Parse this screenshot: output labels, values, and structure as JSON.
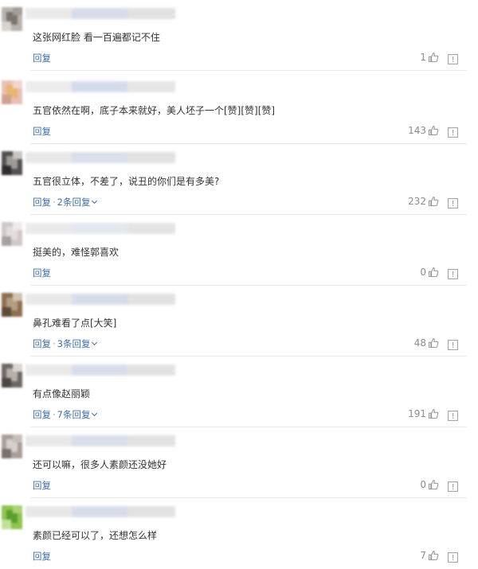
{
  "comments": [
    {
      "text": "这张网红脸 看一百遍都记不住",
      "reply_label": "回复",
      "sub_replies": "",
      "likes": "1",
      "avatar_colors": [
        "#b9b3ad",
        "#7b746f",
        "#d8d3cf",
        "#a39d98"
      ],
      "name_colors": [
        "#e6e6e6",
        "#cfd7e4",
        "#dcdcdc"
      ]
    },
    {
      "text": "五官依然在啊，底子本来就好，美人坯子一个[赞][赞][赞]",
      "reply_label": "回复",
      "sub_replies": "",
      "likes": "143",
      "avatar_colors": [
        "#e7c0b4",
        "#eab56c",
        "#cfa08e",
        "#f0d6cc"
      ],
      "name_colors": [
        "#e9e9e9",
        "#cdd6e6",
        "#e2e2e2"
      ]
    },
    {
      "text": "五官很立体，不差了，说丑的你们是有多美?",
      "reply_label": "回复",
      "sub_replies": "2条回复",
      "likes": "232",
      "avatar_colors": [
        "#545050",
        "#9e9a98",
        "#2f2c2c",
        "#c8c4c2"
      ],
      "name_colors": [
        "#e4e4e4",
        "#d3dbe8",
        "#dddddd"
      ]
    },
    {
      "text": "挺美的，难怪郭喜欢",
      "reply_label": "回复",
      "sub_replies": "",
      "likes": "0",
      "avatar_colors": [
        "#cfc8c8",
        "#e3dede",
        "#a89f9f",
        "#eeeaea"
      ],
      "name_colors": [
        "#e6e6e6",
        "#dfe4ee",
        "#e0e0e0"
      ]
    },
    {
      "text": "鼻孔难看了点[大笑]",
      "reply_label": "回复",
      "sub_replies": "3条回复",
      "likes": "48",
      "avatar_colors": [
        "#8c6f4e",
        "#b39d83",
        "#5f4a36",
        "#d2c3b1"
      ],
      "name_colors": [
        "#e4e4e4",
        "#d0d8e6",
        "#dcdcdc"
      ]
    },
    {
      "text": "有点像赵丽颖",
      "reply_label": "回复",
      "sub_replies": "7条回复",
      "likes": "191",
      "avatar_colors": [
        "#6e6864",
        "#b6b0ab",
        "#4c4744",
        "#dad5d1"
      ],
      "name_colors": [
        "#e6e6e6",
        "#d1d9e7",
        "#dedede"
      ]
    },
    {
      "text": "还可以嘛，很多人素颜还没她好",
      "reply_label": "回复",
      "sub_replies": "",
      "likes": "0",
      "avatar_colors": [
        "#a79e9a",
        "#d6cfcb",
        "#7a716d",
        "#c7beba"
      ],
      "name_colors": [
        "#e5e5e5",
        "#d2dae8",
        "#dcdcdc"
      ]
    },
    {
      "text": "素颜已经可以了，还想怎么样",
      "reply_label": "回复",
      "sub_replies": "",
      "likes": "7",
      "avatar_colors": [
        "#8fc452",
        "#5aa02c",
        "#c2e09a",
        "#a8d377"
      ],
      "name_colors": [
        "#e5e5e5",
        "#d0d8e6",
        "#dddddd"
      ]
    }
  ],
  "icons": {
    "like": "thumbs-up-icon",
    "report": "report-icon",
    "expand": "chevron-down-icon"
  }
}
